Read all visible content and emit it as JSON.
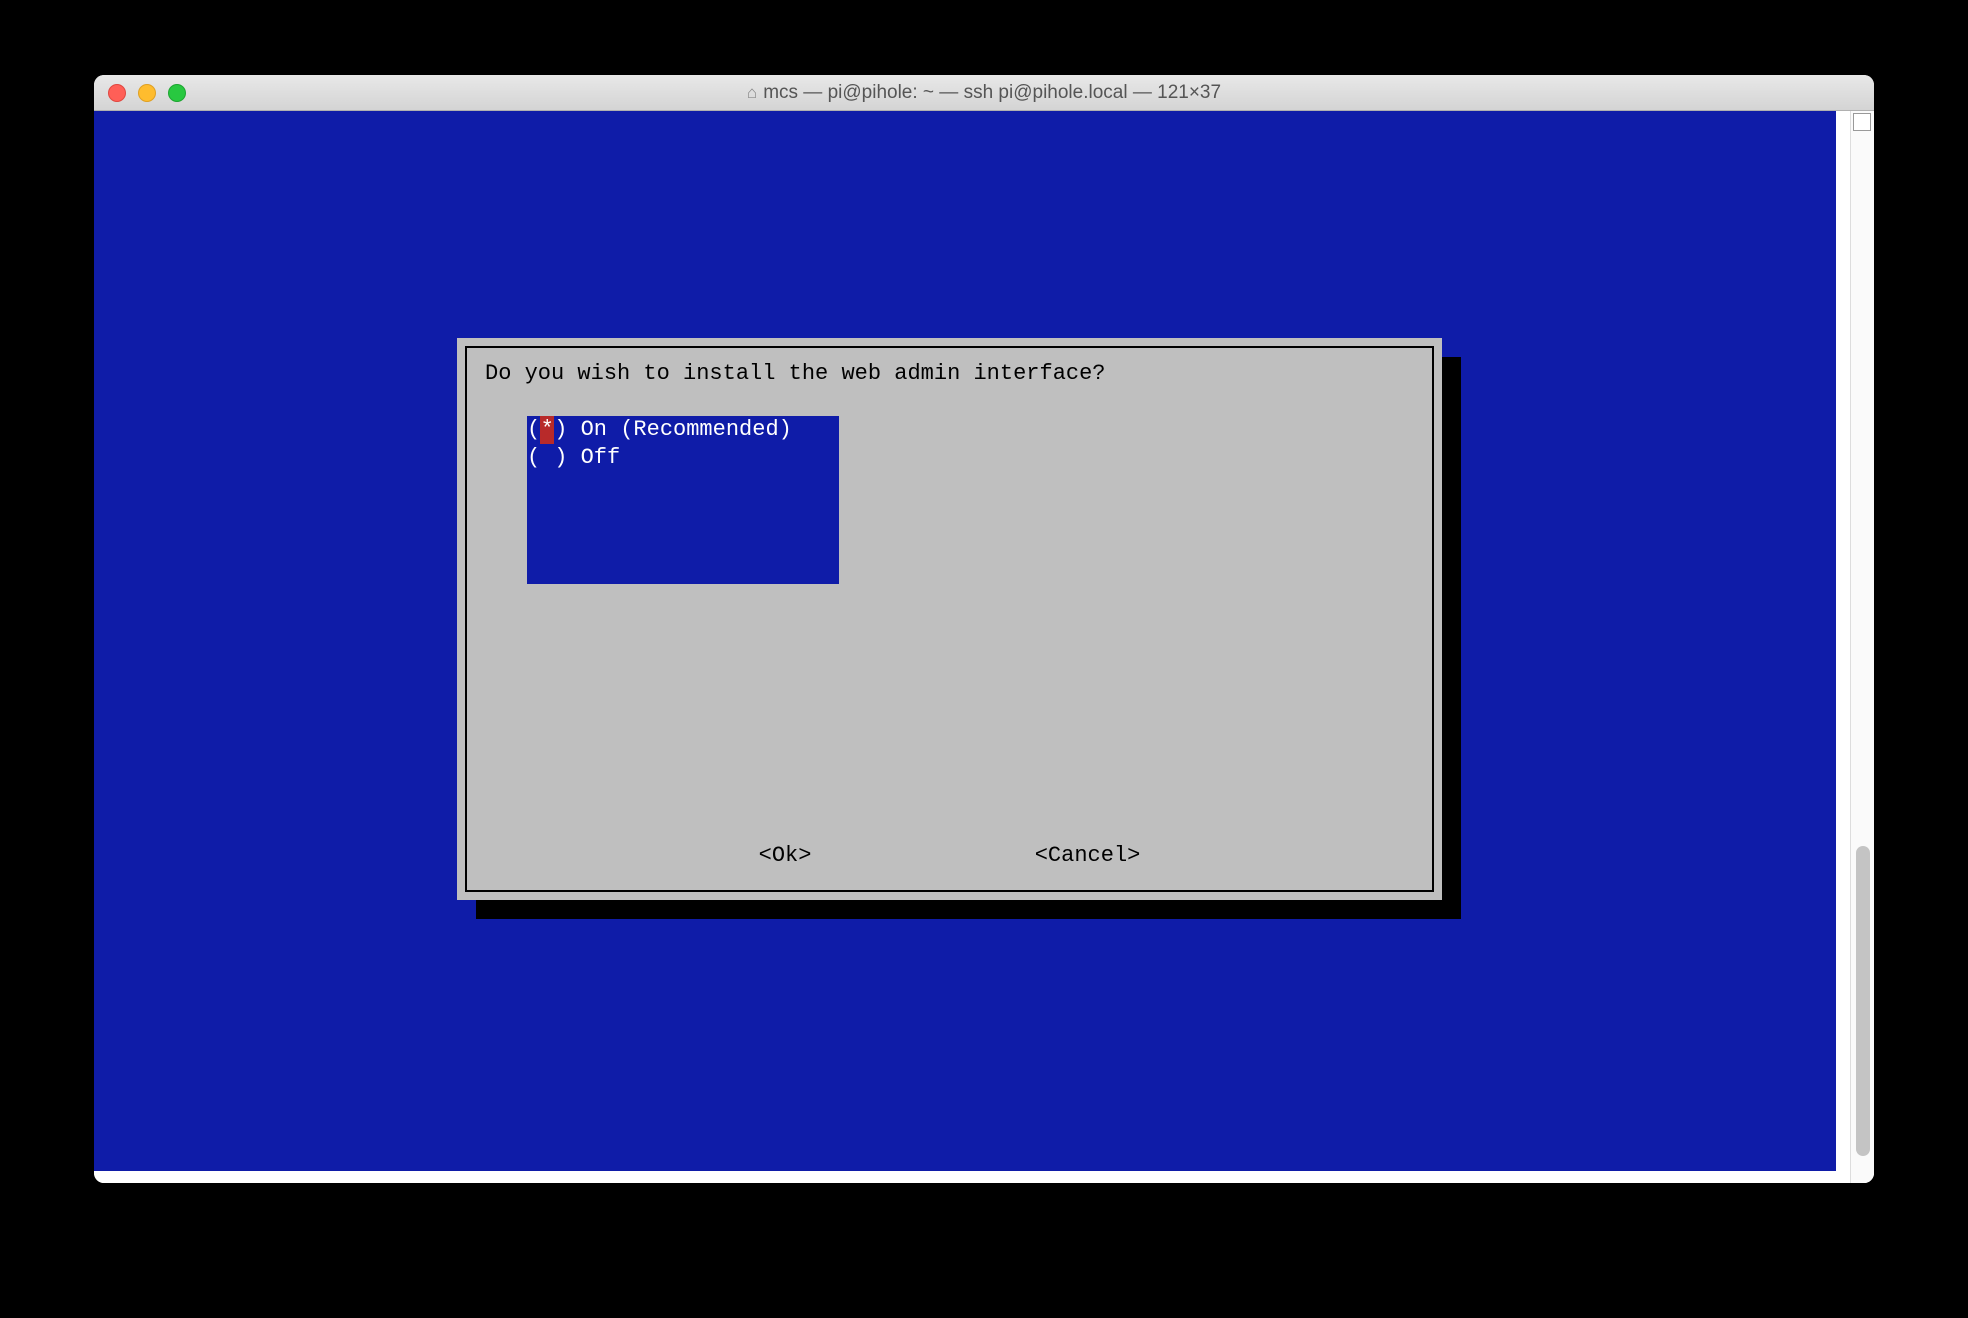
{
  "window": {
    "title": "mcs — pi@pihole: ~ — ssh pi@pihole.local — 121×37",
    "home_icon": "⌂"
  },
  "dialog": {
    "prompt": "Do you wish to install the web admin interface?",
    "options": [
      {
        "mark": "*",
        "label": "On (Recommended)",
        "selected": true
      },
      {
        "mark": " ",
        "label": "Off",
        "selected": false
      }
    ],
    "buttons": {
      "ok": "<Ok>",
      "cancel": "<Cancel>"
    }
  },
  "colors": {
    "terminal_bg": "#0f1ca8",
    "dialog_bg": "#bfbfbf",
    "selected_mark_bg": "#b82a2a"
  }
}
